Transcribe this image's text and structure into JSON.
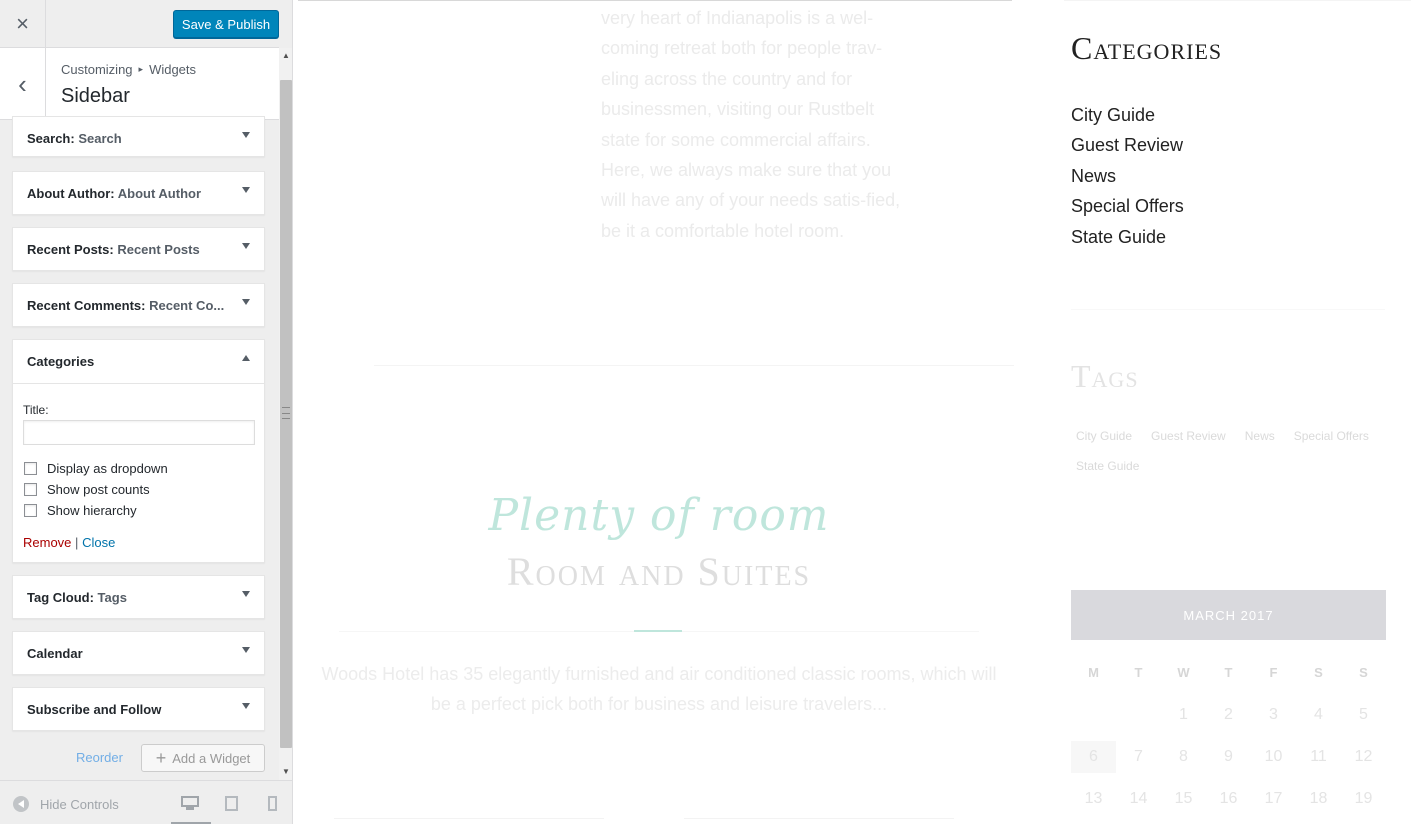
{
  "topbar": {
    "close_icon": "×",
    "publish_label": "Save & Publish"
  },
  "section": {
    "back_icon": "‹",
    "breadcrumb": [
      "Customizing",
      "Widgets"
    ],
    "breadcrumb_sep": "▸",
    "title": "Sidebar"
  },
  "widgets": {
    "search": {
      "type": "Search:",
      "name": "Search"
    },
    "about": {
      "type": "About Author:",
      "name": "About Author"
    },
    "recent_posts": {
      "type": "Recent Posts:",
      "name": "Recent Posts"
    },
    "recent_comments": {
      "type": "Recent Comments:",
      "name": "Recent Co..."
    },
    "categories": {
      "type": "Categories",
      "title_label": "Title:",
      "title_value": "",
      "options": [
        "Display as dropdown",
        "Show post counts",
        "Show hierarchy"
      ],
      "remove_label": "Remove",
      "divider": "|",
      "close_label": "Close"
    },
    "tag_cloud": {
      "type": "Tag Cloud:",
      "name": "Tags"
    },
    "calendar": {
      "type": "Calendar"
    },
    "subscribe": {
      "type": "Subscribe and Follow"
    }
  },
  "actions": {
    "reorder_label": "Reorder",
    "add_widget_label": "Add a Widget",
    "add_icon": "+"
  },
  "footer": {
    "hide_controls_label": "Hide Controls",
    "devices": [
      "desktop",
      "tablet",
      "mobile"
    ],
    "active_device": "desktop"
  },
  "preview": {
    "body_text": "very heart of Indianapolis is a wel-coming retreat both for people trav-eling across the country and for businessmen, visiting our Rustbelt state for some commercial affairs. Here, we always make sure that you will have any of your needs satis-fied, be it a comfortable hotel room.",
    "script_heading": "Plenty of room",
    "room_heading": "Room and Suites",
    "room_desc": "Woods Hotel has 35 elegantly furnished and air conditioned classic rooms, which will be a perfect pick both for business and leisure travelers...",
    "sidebar": {
      "categories_heading": "Categories",
      "categories": [
        "City Guide",
        "Guest Review",
        "News",
        "Special Offers",
        "State Guide"
      ],
      "tags_heading": "Tags",
      "tags": [
        "City Guide",
        "Guest Review",
        "News",
        "Special Offers",
        "State Guide"
      ],
      "calendar_month": "MARCH 2017",
      "weekdays": [
        "M",
        "T",
        "W",
        "T",
        "F",
        "S",
        "S"
      ],
      "weeks": [
        [
          "",
          "",
          "1",
          "2",
          "3",
          "4",
          "5"
        ],
        [
          "6",
          "7",
          "8",
          "9",
          "10",
          "11",
          "12"
        ],
        [
          "13",
          "14",
          "15",
          "16",
          "17",
          "18",
          "19"
        ]
      ],
      "today": "6"
    }
  },
  "colors": {
    "accent": "#0085ba",
    "link": "#0073aa",
    "remove": "#a00",
    "mint": "#bfe6dc"
  }
}
